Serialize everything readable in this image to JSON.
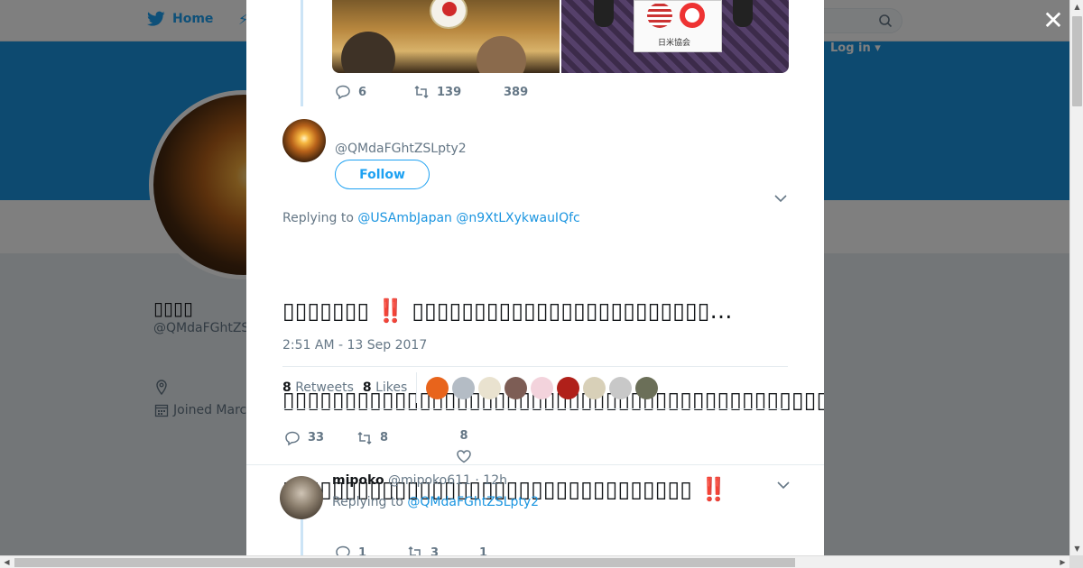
{
  "nav": {
    "home_label": "Home",
    "login_label": "Log in ▾"
  },
  "profile": {
    "name": "▯▯▯▯",
    "handle": "@QMdaFGhtZS",
    "joined": "Joined Marc"
  },
  "prev_tweet": {
    "reply_count": "6",
    "retweet_count": "139",
    "like_count": "389"
  },
  "main_tweet": {
    "handle": "@QMdaFGhtZSLpty2",
    "follow_label": "Follow",
    "replying_prefix": "Replying to",
    "replying_to": [
      "@USAmbJapan",
      "@n9XtLXykwauIQfc"
    ],
    "text_line1": "▯▯▯▯▯▯▯ ‼️ ▯▯▯▯▯▯▯▯▯▯▯▯▯▯▯▯▯▯▯▯▯▯▯▯…",
    "text_line2": "▯▯▯▯▯▯▯▯▯▯▯▯▯▯▯▯▯▯▯▯▯▯▯▯▯▯▯▯▯▯▯▯▯▯▯▯▯▯▯▯▯▯▯▯▯▯▯▯▯▯▯▯▯▯▯▯♪",
    "text_line3": "▯▯▯▯▯▯▯▯▯▯▯▯▯▯▯▯▯▯▯▯▯▯▯▯▯▯▯▯▯▯▯▯▯ ‼️",
    "timestamp": "2:51 AM - 13 Sep 2017",
    "retweets_count": "8",
    "retweets_label": "Retweets",
    "likes_count": "8",
    "likes_label": "Likes",
    "reply_count": "33",
    "retweet_count": "8",
    "like_count": "8",
    "liker_colors": [
      "#e8641c",
      "#b4bcc5",
      "#e9e2cf",
      "#7d5d55",
      "#f3d3dc",
      "#b0201a",
      "#d8d0b8",
      "#c8c8c8",
      "#6b6f58"
    ]
  },
  "reply": {
    "name": "mipoko",
    "handle": "@mipoko611",
    "time": "12h",
    "replying_prefix": "Replying to",
    "replying_to": "@QMdaFGhtZSLpty2",
    "reply_count": "1",
    "retweet_count": "3",
    "like_count": "1"
  },
  "photo_board_text": "日米協会"
}
